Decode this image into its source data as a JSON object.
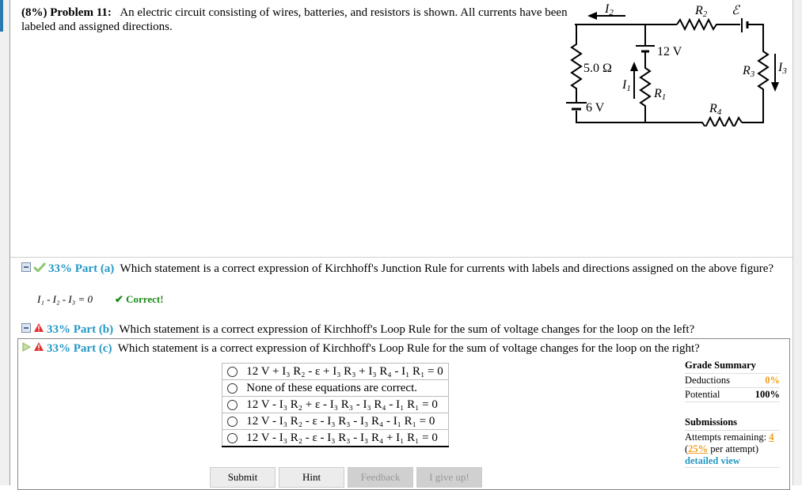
{
  "problem": {
    "prefix": "(8%)  Problem 11:",
    "text": "An electric circuit consisting of wires, batteries, and resistors is shown. All currents have been labeled and assigned directions."
  },
  "circuit": {
    "I1": "I",
    "I1sub": "1",
    "I2": "I",
    "I2sub": "2",
    "I3": "I",
    "I3sub": "3",
    "R1": "R",
    "R1sub": "1",
    "R2": "R",
    "R2sub": "2",
    "R3": "R",
    "R3sub": "3",
    "R4": "R",
    "R4sub": "4",
    "emf": "ℰ",
    "v12": "12 V",
    "v6": "6 V",
    "r5": "5.0 Ω"
  },
  "parts": [
    {
      "percent": "33% Part (a)",
      "question": "Which statement is a correct expression of Kirchhoff's Junction Rule for currents with labels and directions assigned on the above figure?",
      "answer": "I₁ - I₂ - I₃ = 0",
      "feedback": "✔ Correct!",
      "status": "correct"
    },
    {
      "percent": "33% Part (b)",
      "question": "Which statement is a correct expression of Kirchhoff's Loop Rule for the sum of voltage changes for the loop on the left?",
      "status": "warning"
    },
    {
      "percent": "33% Part (c)",
      "question": "Which statement is a correct expression of Kirchhoff's Loop Rule for the sum of voltage changes for the loop on the right?",
      "status": "warning"
    }
  ],
  "options": [
    "12 V + I₃ R₂ - ε + I₃ R₃ + I₃ R₄ - I₁ R₁ = 0",
    "None of these equations are correct.",
    "12 V - I₃ R₂ + ε - I₃ R₃ - I₃ R₄ - I₁ R₁ = 0",
    "12 V - I₃ R₂ - ε - I₃ R₃ - I₃ R₄ - I₁ R₁ = 0",
    "12 V - I₃ R₂ - ε - I₃ R₃ - I₃ R₄ + I₁ R₁ = 0"
  ],
  "grade": {
    "title": "Grade Summary",
    "deductions_label": "Deductions",
    "deductions": "0%",
    "potential_label": "Potential",
    "potential": "100%",
    "submissions_title": "Submissions",
    "attempts_label": "Attempts remaining:",
    "attempts": "4",
    "per_open": "(",
    "per_pct": "25%",
    "per_text": " per attempt)",
    "detailed": "detailed view"
  },
  "buttons": {
    "submit": "Submit",
    "hint": "Hint",
    "feedback": "Feedback",
    "giveup": "I give up!"
  },
  "colors": {
    "accent": "#2398c5",
    "orange": "#f0a020",
    "correct": "#1a8a1a",
    "warning": "#d02020"
  }
}
